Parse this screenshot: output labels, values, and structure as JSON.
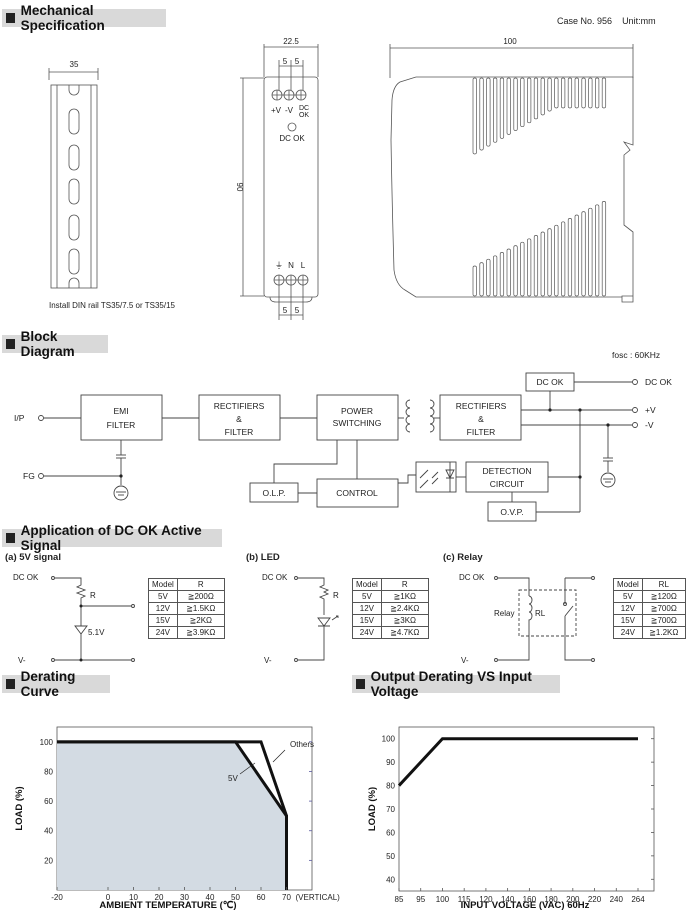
{
  "mechanical": {
    "title": "Mechanical Specification",
    "case_no": "Case No. 956",
    "unit": "Unit:mm",
    "din_width": "35",
    "din_caption": "Install DIN rail TS35/7.5 or TS35/15",
    "front_width": "22.5",
    "front_height": "90",
    "pitch": "5",
    "out_terminals": [
      "+V",
      "-V",
      "DC OK"
    ],
    "led_label": "DC OK",
    "in_terminals": [
      "⏚",
      "N",
      "L"
    ],
    "side_width": "100"
  },
  "block": {
    "title": "Block Diagram",
    "fosc": "fosc : 60KHz",
    "ip": "I/P",
    "fg": "FG",
    "emi": [
      "EMI",
      "FILTER"
    ],
    "rect1": [
      "RECTIFIERS",
      "&",
      "FILTER"
    ],
    "power": [
      "POWER",
      "SWITCHING"
    ],
    "rect2": [
      "RECTIFIERS",
      "&",
      "FILTER"
    ],
    "dcok_box": "DC OK",
    "dcok_out": "DC OK",
    "vplus": "+V",
    "vminus": "-V",
    "detection": [
      "DETECTION",
      "CIRCUIT"
    ],
    "olp": "O.L.P.",
    "control": "CONTROL",
    "ovp": "O.V.P."
  },
  "application": {
    "title": "Application of DC OK Active Signal",
    "a": {
      "title": "(a) 5V signal",
      "dcok": "DC OK",
      "vminus": "V-",
      "r": "R",
      "zener": "5.1V",
      "headers": [
        "Model",
        "R"
      ],
      "rows": [
        [
          "5V",
          "≧200Ω"
        ],
        [
          "12V",
          "≧1.5KΩ"
        ],
        [
          "15V",
          "≧2KΩ"
        ],
        [
          "24V",
          "≧3.9KΩ"
        ]
      ]
    },
    "b": {
      "title": "(b) LED",
      "dcok": "DC OK",
      "vminus": "V-",
      "r": "R",
      "headers": [
        "Model",
        "R"
      ],
      "rows": [
        [
          "5V",
          "≧1KΩ"
        ],
        [
          "12V",
          "≧2.4KΩ"
        ],
        [
          "15V",
          "≧3KΩ"
        ],
        [
          "24V",
          "≧4.7KΩ"
        ]
      ]
    },
    "c": {
      "title": "(c) Relay",
      "dcok": "DC OK",
      "vminus": "V-",
      "relay": "Relay",
      "rl": "RL",
      "headers": [
        "Model",
        "RL"
      ],
      "rows": [
        [
          "5V",
          "≧120Ω"
        ],
        [
          "12V",
          "≧700Ω"
        ],
        [
          "15V",
          "≧700Ω"
        ],
        [
          "24V",
          "≧1.2KΩ"
        ]
      ]
    }
  },
  "chart_data": [
    {
      "type": "line",
      "title": "Derating Curve",
      "xlabel": "AMBIENT TEMPERATURE (℃)",
      "ylabel": "LOAD (%)",
      "x_ticks": [
        "-20",
        "0",
        "10",
        "20",
        "30",
        "40",
        "50",
        "60",
        "70"
      ],
      "x_suffix": "(VERTICAL)",
      "y_ticks": [
        "20",
        "40",
        "60",
        "80",
        "100"
      ],
      "xlim": [
        -20,
        80
      ],
      "ylim": [
        0,
        110
      ],
      "series": [
        {
          "name": "5V",
          "x": [
            -20,
            50,
            70,
            70
          ],
          "y": [
            100,
            100,
            50,
            0
          ],
          "filled": true
        },
        {
          "name": "Others",
          "x": [
            -20,
            60,
            70,
            70
          ],
          "y": [
            100,
            100,
            50,
            0
          ]
        }
      ],
      "annotations": [
        "Others",
        "5V"
      ],
      "fill_color": "#d3dbe3"
    },
    {
      "type": "line",
      "title": "Output Derating VS Input Voltage",
      "xlabel": "INPUT VOLTAGE (VAC) 60Hz",
      "ylabel": "LOAD (%)",
      "x_ticks": [
        "85",
        "95",
        "100",
        "115",
        "120",
        "140",
        "160",
        "180",
        "200",
        "220",
        "240",
        "264"
      ],
      "y_ticks": [
        "40",
        "50",
        "60",
        "70",
        "80",
        "90",
        "100"
      ],
      "ylim": [
        35,
        105
      ],
      "series": [
        {
          "name": "Load",
          "x": [
            "85",
            "100",
            "264"
          ],
          "y": [
            80,
            100,
            100
          ]
        }
      ]
    }
  ]
}
